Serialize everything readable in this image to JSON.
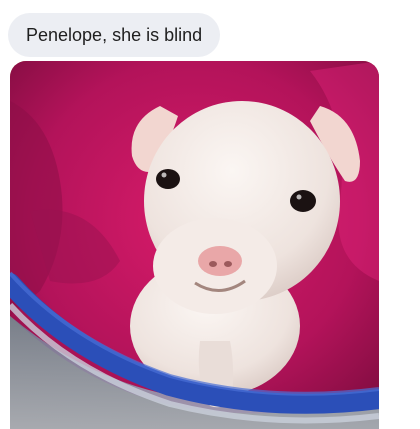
{
  "message": {
    "text": "Penelope, she is blind"
  },
  "photo": {
    "subject_icon": "puppy-in-bucket-image"
  },
  "colors": {
    "bubble_bg": "#eceef3",
    "blanket": "#c2185b",
    "bucket_rim": "#2b4fb8",
    "puppy": "#efe6e2"
  }
}
